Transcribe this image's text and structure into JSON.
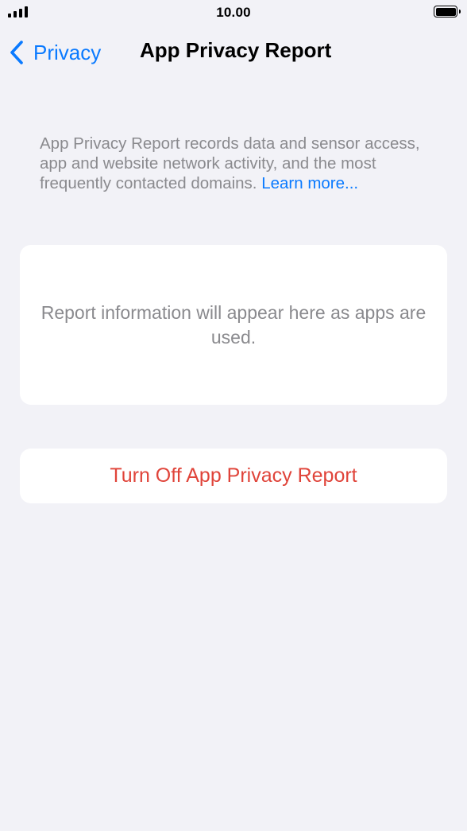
{
  "status_bar": {
    "time": "10.00",
    "signal_icon": "cellular-signal-icon",
    "battery_icon": "battery-full-icon"
  },
  "nav": {
    "back_label": "Privacy",
    "back_icon": "chevron-left-icon",
    "title": "App Privacy Report"
  },
  "description": {
    "text": "App Privacy Report records data and sensor access, app and website network activity, and the most frequently contacted domains.",
    "link_label": "Learn more..."
  },
  "report": {
    "empty_message": "Report information will appear here as apps are used."
  },
  "actions": {
    "turn_off_label": "Turn Off App Privacy Report"
  },
  "colors": {
    "background": "#f2f2f7",
    "accent": "#0a7aff",
    "destructive": "#e0443a",
    "secondary_text": "#8a8a8e"
  }
}
